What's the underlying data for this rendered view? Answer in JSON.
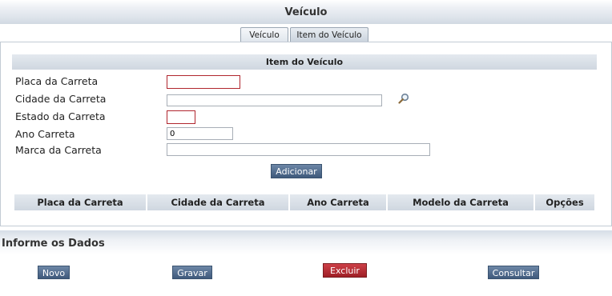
{
  "header": {
    "title": "Veículo"
  },
  "tabs": [
    {
      "label": "Veículo"
    },
    {
      "label": "Item do Veículo"
    }
  ],
  "section": {
    "title": "Item do Veículo"
  },
  "form": {
    "placa": {
      "label": "Placa da Carreta",
      "value": ""
    },
    "cidade": {
      "label": "Cidade da Carreta",
      "value": ""
    },
    "estado": {
      "label": "Estado da Carreta",
      "value": ""
    },
    "ano": {
      "label": "Ano Carreta",
      "value": "0"
    },
    "marca": {
      "label": "Marca da Carreta",
      "value": ""
    },
    "add_label": "Adicionar"
  },
  "table": {
    "headers": [
      "Placa da Carreta",
      "Cidade da Carreta",
      "Ano Carreta",
      "Modelo da Carreta",
      "Opções"
    ]
  },
  "info": {
    "title": "Informe os Dados"
  },
  "actions": {
    "novo": "Novo",
    "gravar": "Gravar",
    "excluir": "Excluir",
    "consultar": "Consultar"
  },
  "icons": {
    "lookup": "search-icon"
  },
  "colors": {
    "required_border": "#b0262e",
    "button": "#4f6a8c",
    "danger": "#b72a32"
  }
}
